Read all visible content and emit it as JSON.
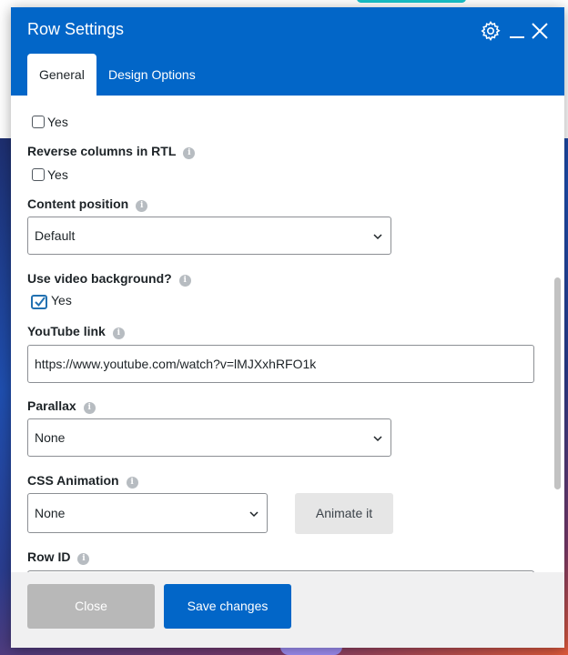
{
  "dialog": {
    "title": "Row Settings",
    "tabs": [
      {
        "label": "General",
        "active": true
      },
      {
        "label": "Design Options",
        "active": false
      }
    ],
    "header_icons": [
      "gear-icon",
      "minimize-icon",
      "close-icon"
    ]
  },
  "fields": {
    "top_option": {
      "checkbox_label": "Yes",
      "checked": false
    },
    "reverse_columns": {
      "label": "Reverse columns in RTL",
      "checkbox_label": "Yes",
      "checked": false
    },
    "content_position": {
      "label": "Content position",
      "value": "Default"
    },
    "video_background": {
      "label": "Use video background?",
      "checkbox_label": "Yes",
      "checked": true
    },
    "youtube_link": {
      "label": "YouTube link",
      "value": "https://www.youtube.com/watch?v=lMJXxhRFO1k"
    },
    "parallax": {
      "label": "Parallax",
      "value": "None"
    },
    "css_animation": {
      "label": "CSS Animation",
      "value": "None",
      "button": "Animate it"
    },
    "row_id": {
      "label": "Row ID"
    }
  },
  "footer": {
    "close_label": "Close",
    "save_label": "Save changes"
  },
  "colors": {
    "header": "#0266c8",
    "save_button": "#0266c8",
    "close_button": "#b8b8b8",
    "checkbox_checked": "#2271b1"
  }
}
